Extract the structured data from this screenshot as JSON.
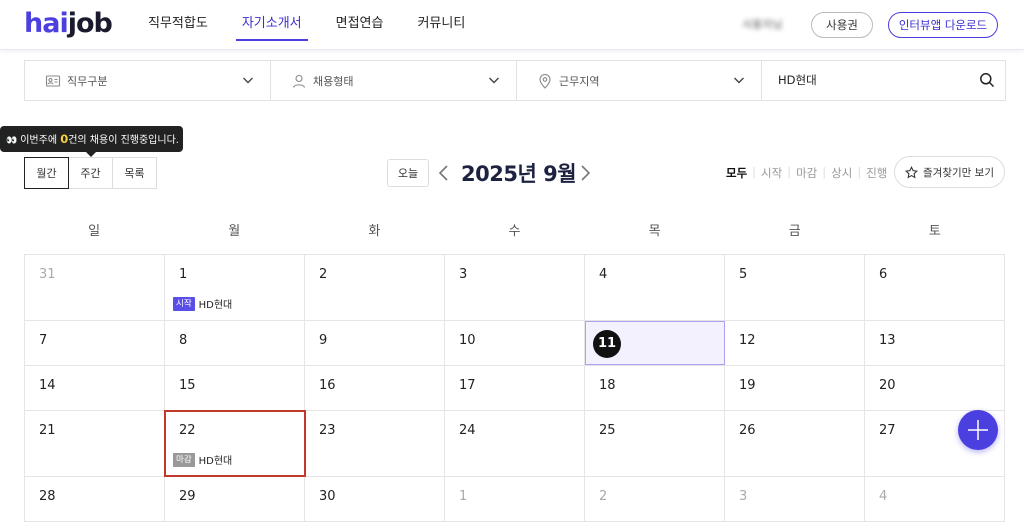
{
  "header": {
    "logo_part1": "hai",
    "logo_part2": "job",
    "nav": [
      "직무적합도",
      "자기소개서",
      "면접연습",
      "커뮤니티"
    ],
    "active_nav": 1,
    "user_name": "사용자님",
    "ticket_label": "사용권",
    "app_label": "인터뷰앱 다운로드"
  },
  "filters": {
    "job_category": "직무구분",
    "employment_type": "채용형태",
    "location": "근무지역",
    "search_value": "HD현대"
  },
  "tooltip": {
    "eyes": "👀",
    "prefix": "이번주에 ",
    "count": "0",
    "suffix": "건의 채용이 진행중입니다."
  },
  "views": [
    "월간",
    "주간",
    "목록"
  ],
  "active_view": 0,
  "month_nav": {
    "today_label": "오늘",
    "title": "2025년 9월"
  },
  "status_filter": [
    "모두",
    "시작",
    "마감",
    "상시",
    "진행"
  ],
  "active_status": 0,
  "favorites_label": "즐겨찾기만 보기",
  "weekdays": [
    "일",
    "월",
    "화",
    "수",
    "목",
    "금",
    "토"
  ],
  "weeks": [
    {
      "height": 66,
      "days": [
        {
          "n": "31",
          "other": true
        },
        {
          "n": "1",
          "event": {
            "badge": "시작",
            "type": "start",
            "label": "HD현대"
          }
        },
        {
          "n": "2"
        },
        {
          "n": "3"
        },
        {
          "n": "4"
        },
        {
          "n": "5"
        },
        {
          "n": "6"
        }
      ]
    },
    {
      "height": 45,
      "days": [
        {
          "n": "7"
        },
        {
          "n": "8"
        },
        {
          "n": "9"
        },
        {
          "n": "10"
        },
        {
          "n": "11",
          "today": true
        },
        {
          "n": "12"
        },
        {
          "n": "13"
        }
      ]
    },
    {
      "height": 45,
      "days": [
        {
          "n": "14"
        },
        {
          "n": "15"
        },
        {
          "n": "16"
        },
        {
          "n": "17"
        },
        {
          "n": "18"
        },
        {
          "n": "19"
        },
        {
          "n": "20"
        }
      ]
    },
    {
      "height": 66,
      "days": [
        {
          "n": "21"
        },
        {
          "n": "22",
          "selected": true,
          "event": {
            "badge": "마감",
            "type": "end",
            "label": "HD현대"
          }
        },
        {
          "n": "23"
        },
        {
          "n": "24"
        },
        {
          "n": "25"
        },
        {
          "n": "26"
        },
        {
          "n": "27"
        }
      ]
    },
    {
      "height": 45,
      "days": [
        {
          "n": "28"
        },
        {
          "n": "29"
        },
        {
          "n": "30"
        },
        {
          "n": "1",
          "other": true
        },
        {
          "n": "2",
          "other": true
        },
        {
          "n": "3",
          "other": true
        },
        {
          "n": "4",
          "other": true
        }
      ]
    }
  ],
  "colors": {
    "brand": "#4b3fe0",
    "start_badge": "#5a4ee8",
    "end_badge": "#999999",
    "selected_border": "#c0392b",
    "today_bg": "#f3f1fe"
  }
}
